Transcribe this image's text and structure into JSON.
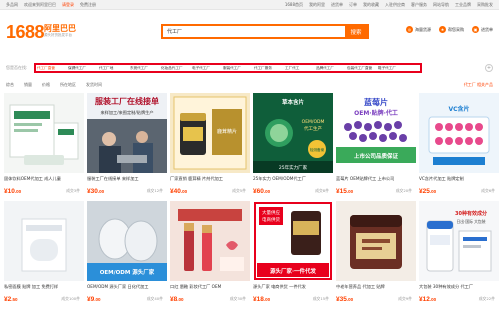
{
  "topbar": {
    "items_left": [
      "多品网",
      "欢迎来到阿里巴巴",
      "请登录",
      "免费注册"
    ],
    "items_right": [
      "1688首页",
      "我的阿里",
      "进货单",
      "订单",
      "我的收藏",
      "入驻供应商",
      "客户服务",
      "网站导航",
      "工业品牌",
      "采购批发"
    ]
  },
  "logo": {
    "text": "1688",
    "name_cn": "阿里巴巴",
    "tagline": "源头好货批发平台"
  },
  "search": {
    "value": "代工厂",
    "button_label": "搜索"
  },
  "header_icons": [
    {
      "icon": "globe-icon",
      "label": "海量货源"
    },
    {
      "icon": "star-icon",
      "label": "帮您采购"
    },
    {
      "icon": "cart-icon",
      "label": "进货单"
    }
  ],
  "filter": {
    "label": "您是否在找:",
    "tags": [
      "代工厂直营",
      "保健代工厂",
      "代工厂地",
      "东莞代工厂",
      "化妆品代工厂",
      "电子代工厂",
      "服装代工厂",
      "代工厂服务",
      "工厂代工",
      "品牌代工厂",
      "包装代工厂直营",
      "鞋子代工厂",
      "代工厂oem"
    ],
    "more_label": "+"
  },
  "sortbar": {
    "items": [
      "综合",
      "销量",
      "价格",
      "所在地区",
      "发货时间"
    ],
    "result_label": "代工厂 相关产品"
  },
  "colors": {
    "brand": "#ff6a00",
    "price": "#ff4000",
    "highlight_border": "#e8001c"
  },
  "products": [
    {
      "title": "固体饮料OEM代加工 成人儿童",
      "hl": "代工",
      "price": "10",
      "unit": ".00",
      "sold": "成交3件"
    },
    {
      "title": "服装工厂在线接单 来样加工",
      "hl": "代工",
      "price": "30",
      "unit": ".00",
      "sold": "成交12件"
    },
    {
      "title": "厂家直销 鹿茸精 片剂代加工",
      "hl": "代工",
      "price": "40",
      "unit": ".00",
      "sold": "成交5件"
    },
    {
      "title": "25年实力 OEM/ODM代工厂",
      "hl": "代工厂",
      "price": "60",
      "unit": ".00",
      "sold": "成交8件"
    },
    {
      "title": "蓝莓片 OEM贴牌代工 上市公司",
      "hl": "代工",
      "price": "15",
      "unit": ".00",
      "sold": "成交20件"
    },
    {
      "title": "VC含片代加工 贴牌定制",
      "hl": "代工",
      "price": "25",
      "unit": ".00",
      "sold": "成交6件"
    },
    {
      "title": "私密面膜 贴牌 加工 免费打样",
      "hl": "代工",
      "price": "2",
      "unit": ".50",
      "sold": "成交100件"
    },
    {
      "title": "OEM/ODM 源头厂家 日化代加工",
      "hl": "代工",
      "price": "9",
      "unit": ".00",
      "sold": "成交40件"
    },
    {
      "title": "口红 唇釉 彩妆代工厂 OEM",
      "hl": "代工厂",
      "price": "8",
      "unit": ".00",
      "sold": "成交30件"
    },
    {
      "title": "源头厂家 电商供货 一件代发",
      "hl": "代工",
      "price": "18",
      "unit": ".00",
      "sold": "成交15件"
    },
    {
      "title": "中老年营养品 代加工 贴牌",
      "hl": "代工",
      "price": "35",
      "unit": ".00",
      "sold": "成交9件"
    },
    {
      "title": "大包装 30种有效成分 代工厂",
      "hl": "代工厂",
      "price": "12",
      "unit": ".00",
      "sold": "成交22件"
    }
  ],
  "banner_texts": {
    "p2": "服装工厂在线接单",
    "p2b": "来样加工/来图定制/贴牌生产",
    "p3": "鹿茸精片",
    "p4": "草本含片",
    "p4b": "25年实力厂家",
    "p4c": "检测备案",
    "p4d": "OEM/ODM",
    "p4e": "代工生产",
    "p5": "蓝莓片",
    "p5b": "OEM·贴牌·代工",
    "p5c": "上市公司品质保证",
    "p6": "VC含片",
    "p8": "OEM/ODM 源头厂家",
    "p10": "大量供应",
    "p10b": "电商供货",
    "p10c": "源头厂家·一件代发",
    "p12": "30种有效成分",
    "p12b": "日出·国际 大包装"
  }
}
